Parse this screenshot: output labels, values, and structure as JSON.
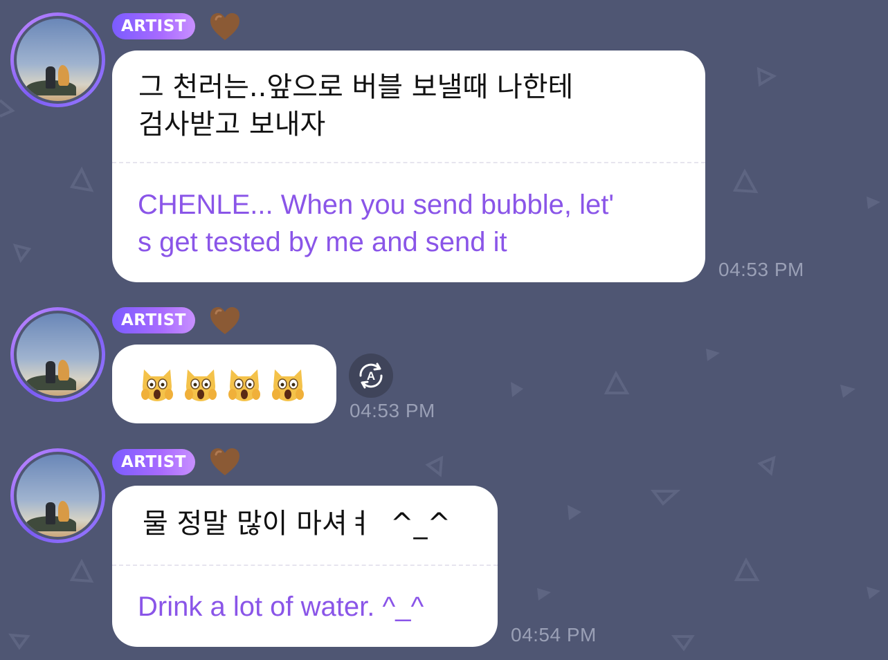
{
  "colors": {
    "background": "#4f5673",
    "bubble": "#ffffff",
    "korean_text": "#111111",
    "translation_text": "#8a55e8",
    "badge_gradient_start": "#7b5cff",
    "badge_gradient_end": "#c890ff",
    "timestamp": "#9aa0b6"
  },
  "messages": [
    {
      "badge": "ARTIST",
      "heart_icon": "brown-heart-icon",
      "korean_line1": "그 천러는..앞으로 버블 보낼때 나한테",
      "korean_line2": "검사받고 보내자",
      "translation_line1": "CHENLE... When you send bubble, let'",
      "translation_line2": "s get tested by me and send it",
      "time": "04:53 PM"
    },
    {
      "badge": "ARTIST",
      "heart_icon": "brown-heart-icon",
      "emoji": "😱",
      "emoji_count": 4,
      "translate_icon": "auto-translate-icon",
      "translate_letter": "A",
      "time": "04:53 PM"
    },
    {
      "badge": "ARTIST",
      "heart_icon": "brown-heart-icon",
      "korean_line1": "물 정말 많이 마셔ㅕ  ^_^",
      "translation_line1": "Drink a lot of water. ^_^",
      "time": "04:54 PM"
    }
  ]
}
